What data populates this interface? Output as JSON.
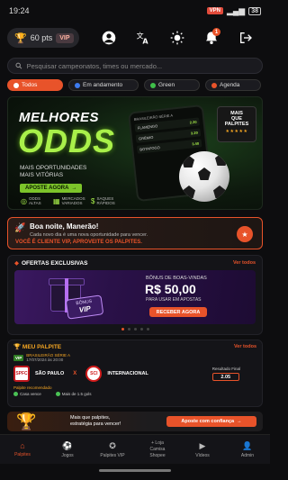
{
  "status_bar": {
    "time": "19:24",
    "vpn": "VPN",
    "battery": "38"
  },
  "header": {
    "points": "60 pts",
    "vip": "VIP",
    "notifications": "1"
  },
  "search": {
    "placeholder": "Pesquisar campeonatos, times ou mercado..."
  },
  "filters": [
    {
      "label": "Todos",
      "color": "#e8532a"
    },
    {
      "label": "Em andamento",
      "color": "#3d7bf0"
    },
    {
      "label": "Green",
      "color": "#3fbf4a"
    },
    {
      "label": "Agenda",
      "color": "#e8532a"
    }
  ],
  "hero": {
    "title_1": "MELHORES",
    "title_2": "ODDS",
    "subtitle_1": "MAIS OPORTUNIDADES",
    "subtitle_2": "MAIS VITÓRIAS",
    "cta": "APOSTE AGORA",
    "features": [
      {
        "l1": "ODDS",
        "l2": "ALTAS"
      },
      {
        "l1": "MERCADOS",
        "l2": "VARIADOS"
      },
      {
        "l1": "SAQUES",
        "l2": "RÁPIDOS"
      }
    ],
    "badge_1": "MAIS",
    "badge_2": "QUE",
    "badge_3": "PALPITES",
    "badge_stars": "★★★★★",
    "phone": {
      "title": "BRASILEIRÃO SÉRIE A",
      "rows": [
        {
          "team": "FLAMENGO",
          "odd": "2.20"
        },
        {
          "team": "GRÊMIO",
          "odd": "3.20"
        },
        {
          "team": "BOTAFOGO",
          "odd": "3.40"
        }
      ]
    }
  },
  "greeting": {
    "title": "Boa noite, Manerão!",
    "text": "Cada novo dia é uma nova oportunidade para vencer.",
    "vip_line": "VOCÊ É CLIENTE VIP, APROVEITE OS PALPITES."
  },
  "offers": {
    "title": "OFERTAS EXCLUSIVAS",
    "see_all": "Ver todos",
    "bonus_label": "BÔNUS DE BOAS-VINDAS",
    "amount": "R$ 50,00",
    "usage": "PARA USAR EM APOSTAS",
    "button": "RECEBER AGORA",
    "tag_top": "BÔNUS",
    "tag_main": "VIP"
  },
  "palpite": {
    "title": "MEU PALPITE",
    "see_all": "Ver todos",
    "league": "BRASILEIRÃO SÉRIE A",
    "date": "17/07/2024 às 20:00",
    "vip": "VIP",
    "home": "SÃO PAULO",
    "away": "INTERNACIONAL",
    "vs": "X",
    "result_label": "Resultado Final",
    "result_value": "2.05",
    "recommended": "Palpite recomendado",
    "picks": [
      "Casa vence",
      "Mais de 1.5 gols"
    ],
    "home_crest": "SPFC",
    "away_crest": "SCI"
  },
  "promo": {
    "text_1": "Mais que palpites,",
    "text_2": "estratégia para vencer!",
    "button": "Aposte com confiança"
  },
  "nav": [
    {
      "label": "Palpites",
      "icon": "home-icon",
      "active": true
    },
    {
      "label": "Jogos",
      "icon": "soccer-ball-icon",
      "active": false
    },
    {
      "label": "Palpites VIP",
      "icon": "vip-star-icon",
      "active": false
    },
    {
      "label": "Loja Camisa Shopee",
      "label_1": "+ Loja",
      "label_2": "Camisa",
      "label_3": "Shopee",
      "icon": "shirt-icon",
      "active": false
    },
    {
      "label": "Vídeos",
      "icon": "play-icon",
      "active": false
    },
    {
      "label": "Admin",
      "icon": "admin-user-icon",
      "active": false
    }
  ]
}
